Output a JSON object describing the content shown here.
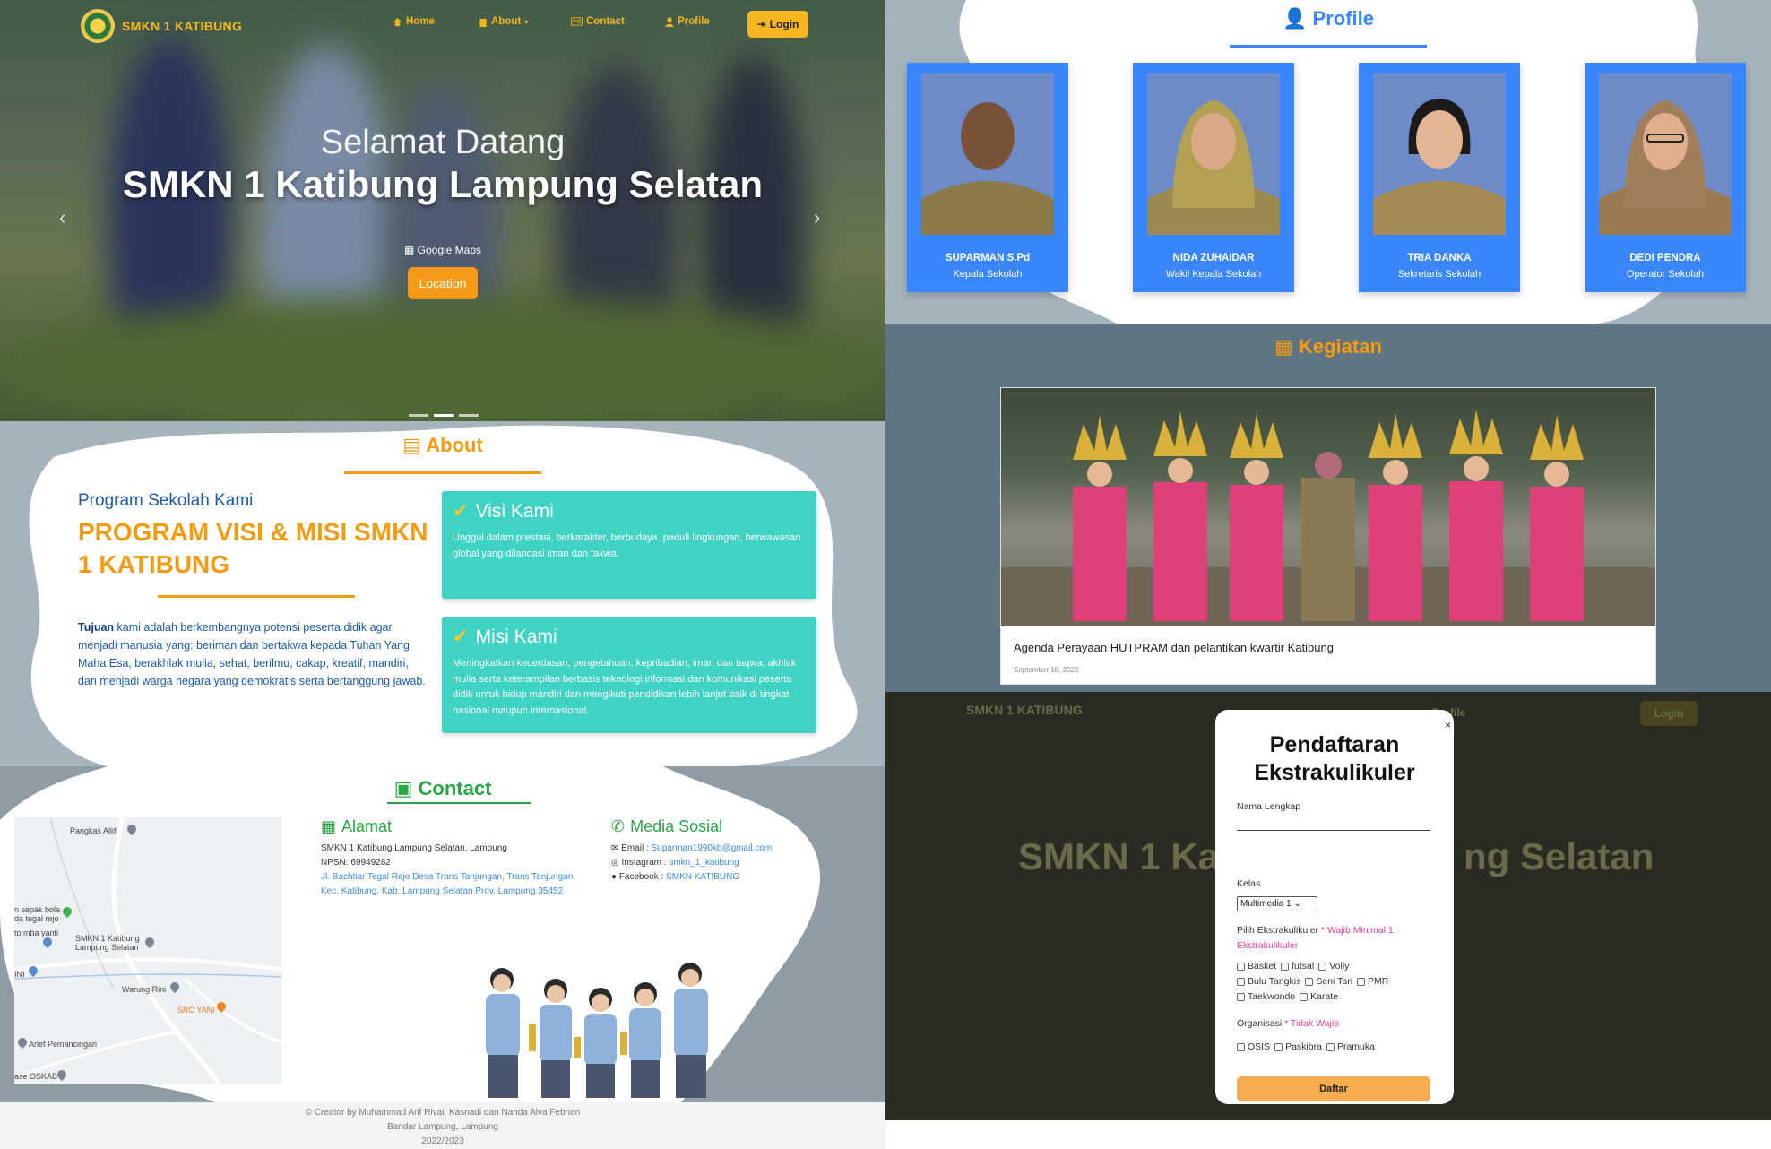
{
  "navbar": {
    "brand": "SMKN 1 KATIBUNG",
    "links": [
      "Home",
      "About",
      "Contact",
      "Profile"
    ],
    "login": "Login"
  },
  "hero": {
    "subtitle": "Selamat Datang",
    "title": "SMKN 1 Katibung Lampung Selatan",
    "maps_label": "Google Maps",
    "location_button": "Location"
  },
  "about": {
    "heading": "About",
    "program_sub": "Program Sekolah Kami",
    "program_title": "PROGRAM VISI & MISI SMKN 1 KATIBUNG",
    "tujuan_bold": "Tujuan",
    "tujuan_text": " kami adalah berkembangnya potensi peserta didik agar menjadi manusia yang: beriman dan bertakwa kepada Tuhan Yang Maha Esa, berakhlak mulia, sehat, berilmu, cakap, kreatif, mandiri, dan menjadi warga negara yang demokratis serta bertanggung jawab.",
    "visi_title": "Visi Kami",
    "visi_text": "Unggul dalam prestasi, berkarakter, berbudaya, peduli lingkungan, berwawasan global yang dilandasi iman dan takwa.",
    "misi_title": "Misi Kami",
    "misi_text": "Meningkatkan kecerdasan, pengetahuan, kepribadian, iman dan taqwa, akhlak mulia serta keterampilan berbasis teknologi informasi dan komunikasi peserta didik untuk hidup mandiri dan mengikuti pendidikan lebih lanjut baik di tingkat nasional maupun internasional."
  },
  "contact": {
    "heading": "Contact",
    "map_labels": [
      "Pangkas Allif",
      "n sepak bola da tegal rejo",
      "to mba yanti",
      "SMKN 1 Katibung Lampung Selatan",
      "INI",
      "Warung Rini",
      "SRC YANI",
      "Arief Pemancingan",
      "ase OSKAB"
    ],
    "alamat_title": "Alamat",
    "alamat_line1": "SMKN 1 Katibung Lampung Selatan, Lampung",
    "alamat_line2": "NPSN: 69949282",
    "alamat_line3": "Jl. Bachtiar Tegal Rejo Desa Trans Tanjungan, Trans Tanjungan, Kec. Katibung, Kab. Lampung Selatan Prov. Lampung 35452",
    "media_title": "Media Sosial",
    "email_label": "Email : ",
    "email": "Suparman1990kb@gmail.com",
    "instagram_label": "Instagram : ",
    "instagram": "smkn_1_katibung",
    "facebook_label": "Facebook : ",
    "facebook": "SMKN KATIBUNG"
  },
  "footer": {
    "line1": "© Creator by Muhammad Arif Rivai, Kasnadi dan Nanda Alva Febrian",
    "line2": "Bandar Lampung, Lampung",
    "line3": "2022/2023"
  },
  "profile": {
    "heading": "Profile",
    "people": [
      {
        "name": "SUPARMAN S.Pd",
        "role": "Kepala Sekolah"
      },
      {
        "name": "NIDA ZUHAIDAR",
        "role": "Wakil Kepala Sekolah"
      },
      {
        "name": "TRIA DANKA",
        "role": "Sekretaris Sekolah"
      },
      {
        "name": "DEDI PENDRA",
        "role": "Operator Sekolah"
      }
    ]
  },
  "kegiatan": {
    "heading": "Kegiatan",
    "title": "Agenda Perayaan HUTPRAM dan pelantikan kwartir Katibung",
    "date": "September 18, 2022"
  },
  "modal": {
    "close": "×",
    "title": "Pendaftaran Ekstrakulikuler",
    "nama_label": "Nama Lengkap",
    "kelas_label": "Kelas",
    "kelas_value": "Multimedia 1",
    "pilih_label": "Pilih Ekstrakulikuler",
    "pilih_req": " * Wajib Minimal 1 Ekstrakulikuler",
    "ekskul_row1": [
      "Basket",
      "futsal",
      "Volly"
    ],
    "ekskul_row2": [
      "Bulu Tangkis",
      "Seni Tari",
      "PMR"
    ],
    "ekskul_row3": [
      "Taekwondo",
      "Karate"
    ],
    "organisasi_label": "Organisasi",
    "organisasi_req": " * Tidak Wajib",
    "organisasi": [
      "OSIS",
      "Paskibra",
      "Pramuka"
    ],
    "submit": "Daftar",
    "bg_brand": "SMKN 1 KATIBUNG",
    "bg_profile": "Profile",
    "bg_login": "Login",
    "bg_title_left": "SMKN 1 Ka",
    "bg_title_right": "ng Selatan"
  },
  "colors": {
    "accent_orange": "#f39c12",
    "accent_blue": "#3a86ff",
    "accent_green": "#28a745",
    "teal": "#3fd3c3"
  }
}
